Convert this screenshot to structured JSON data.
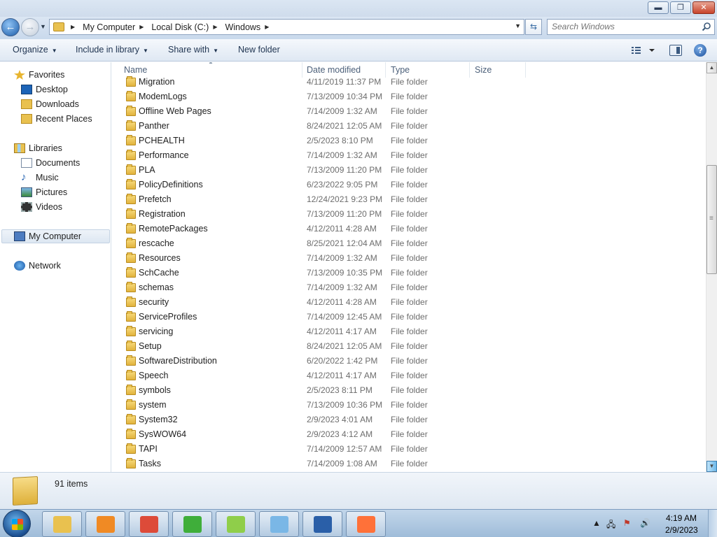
{
  "window": {
    "controls": {
      "minimize": "▬",
      "maximize": "❐",
      "close": "✕"
    }
  },
  "address": {
    "crumbs": [
      "My Computer",
      "Local Disk (C:)",
      "Windows"
    ],
    "refresh_icon": "refresh-icon",
    "search_placeholder": "Search Windows"
  },
  "toolbar": {
    "organize": "Organize",
    "include_in_library": "Include in library",
    "share_with": "Share with",
    "new_folder": "New folder"
  },
  "nav": {
    "favorites": {
      "label": "Favorites",
      "items": [
        "Desktop",
        "Downloads",
        "Recent Places"
      ]
    },
    "libraries": {
      "label": "Libraries",
      "items": [
        "Documents",
        "Music",
        "Pictures",
        "Videos"
      ]
    },
    "computer": "My Computer",
    "network": "Network"
  },
  "columns": {
    "name": "Name",
    "date_modified": "Date modified",
    "type": "Type",
    "size": "Size"
  },
  "files": [
    {
      "name": "Migration",
      "date": "4/11/2019 11:37 PM",
      "type": "File folder"
    },
    {
      "name": "ModemLogs",
      "date": "7/13/2009 10:34 PM",
      "type": "File folder"
    },
    {
      "name": "Offline Web Pages",
      "date": "7/14/2009 1:32 AM",
      "type": "File folder"
    },
    {
      "name": "Panther",
      "date": "8/24/2021 12:05 AM",
      "type": "File folder"
    },
    {
      "name": "PCHEALTH",
      "date": "2/5/2023 8:10 PM",
      "type": "File folder"
    },
    {
      "name": "Performance",
      "date": "7/14/2009 1:32 AM",
      "type": "File folder"
    },
    {
      "name": "PLA",
      "date": "7/13/2009 11:20 PM",
      "type": "File folder"
    },
    {
      "name": "PolicyDefinitions",
      "date": "6/23/2022 9:05 PM",
      "type": "File folder"
    },
    {
      "name": "Prefetch",
      "date": "12/24/2021 9:23 PM",
      "type": "File folder"
    },
    {
      "name": "Registration",
      "date": "7/13/2009 11:20 PM",
      "type": "File folder"
    },
    {
      "name": "RemotePackages",
      "date": "4/12/2011 4:28 AM",
      "type": "File folder"
    },
    {
      "name": "rescache",
      "date": "8/25/2021 12:04 AM",
      "type": "File folder"
    },
    {
      "name": "Resources",
      "date": "7/14/2009 1:32 AM",
      "type": "File folder"
    },
    {
      "name": "SchCache",
      "date": "7/13/2009 10:35 PM",
      "type": "File folder"
    },
    {
      "name": "schemas",
      "date": "7/14/2009 1:32 AM",
      "type": "File folder"
    },
    {
      "name": "security",
      "date": "4/12/2011 4:28 AM",
      "type": "File folder"
    },
    {
      "name": "ServiceProfiles",
      "date": "7/14/2009 12:45 AM",
      "type": "File folder"
    },
    {
      "name": "servicing",
      "date": "4/12/2011 4:17 AM",
      "type": "File folder"
    },
    {
      "name": "Setup",
      "date": "8/24/2021 12:05 AM",
      "type": "File folder"
    },
    {
      "name": "SoftwareDistribution",
      "date": "6/20/2022 1:42 PM",
      "type": "File folder"
    },
    {
      "name": "Speech",
      "date": "4/12/2011 4:17 AM",
      "type": "File folder"
    },
    {
      "name": "symbols",
      "date": "2/5/2023 8:11 PM",
      "type": "File folder"
    },
    {
      "name": "system",
      "date": "7/13/2009 10:36 PM",
      "type": "File folder"
    },
    {
      "name": "System32",
      "date": "2/9/2023 4:01 AM",
      "type": "File folder"
    },
    {
      "name": "SysWOW64",
      "date": "2/9/2023 4:12 AM",
      "type": "File folder"
    },
    {
      "name": "TAPI",
      "date": "7/14/2009 12:57 AM",
      "type": "File folder"
    },
    {
      "name": "Tasks",
      "date": "7/14/2009 1:08 AM",
      "type": "File folder"
    }
  ],
  "details": {
    "count": "91 items"
  },
  "taskbar": {
    "apps": [
      {
        "icon": "file-explorer-icon",
        "color": "#e9c14f"
      },
      {
        "icon": "media-player-icon",
        "color": "#f08a24"
      },
      {
        "icon": "chrome-icon",
        "color": "#dd4b39"
      },
      {
        "icon": "csharp-editor-icon",
        "color": "#3fae3a"
      },
      {
        "icon": "notepad-plus-plus-icon",
        "color": "#8fce4a"
      },
      {
        "icon": "notepad-icon",
        "color": "#7ab7e6"
      },
      {
        "icon": "visual-basic-icon",
        "color": "#2a5fa8"
      },
      {
        "icon": "firefox-icon",
        "color": "#ff7139"
      }
    ],
    "time": "4:19 AM",
    "date": "2/9/2023"
  },
  "scrollbar": {
    "position_fraction": 0.33
  }
}
